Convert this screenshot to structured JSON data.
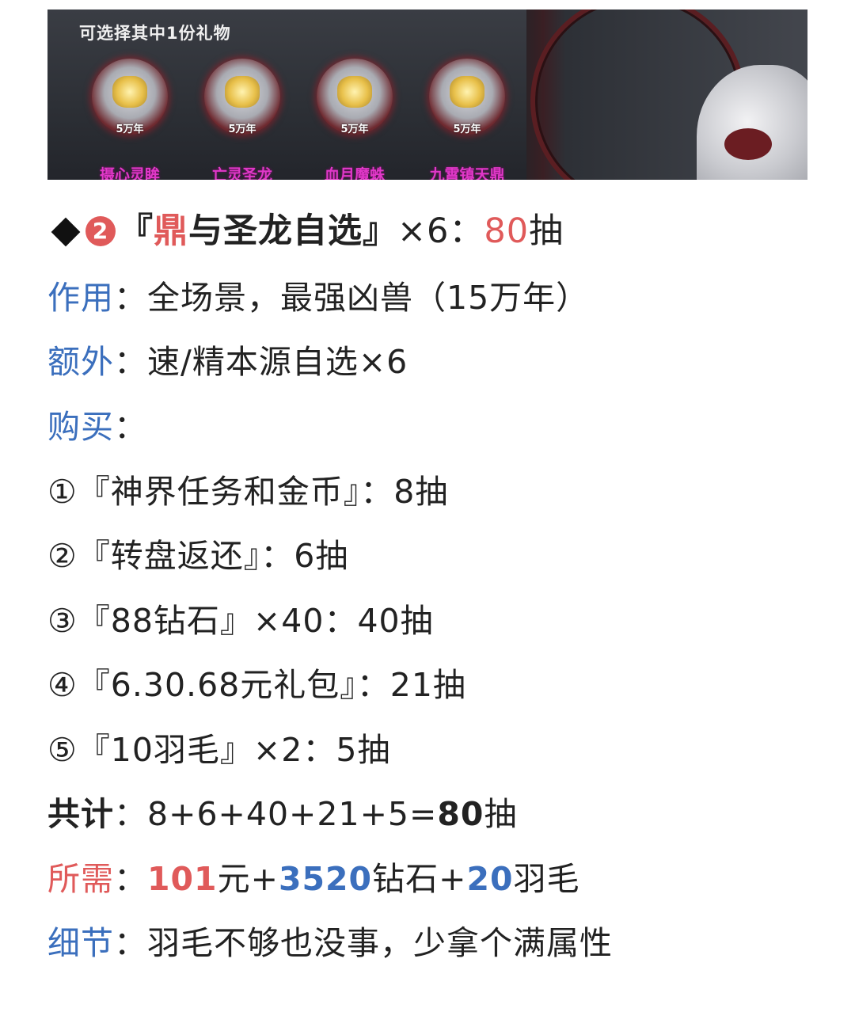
{
  "banner": {
    "title": "可选择其中1份礼物",
    "gifts": [
      {
        "years": "5万年",
        "name": "摄心灵眸",
        "icon": "eye-emblem-icon"
      },
      {
        "years": "5万年",
        "name": "亡灵圣龙",
        "icon": "dragon-emblem-icon"
      },
      {
        "years": "5万年",
        "name": "血月魔蛛",
        "icon": "beast-emblem-icon"
      },
      {
        "years": "5万年",
        "name": "九霄镇天鼎",
        "icon": "cauldron-emblem-icon"
      }
    ]
  },
  "heading": {
    "number": "2",
    "open_quote": "『",
    "title_red": "鼎",
    "title_rest": "与圣龙自选",
    "close_quote": "』",
    "multiplier": "×6：",
    "draws": "80",
    "draws_unit": "抽"
  },
  "effect": {
    "label": "作用",
    "colon": "：",
    "value": "全场景，最强凶兽（15万年）"
  },
  "extra": {
    "label": "额外",
    "colon": "：",
    "value": "速/精本源自选×6"
  },
  "purchase": {
    "label": "购买",
    "colon": "："
  },
  "items": [
    "①『神界任务和金币』：8抽",
    "②『转盘返还』：6抽",
    "③『88钻石』×40：40抽",
    "④『6.30.68元礼包』：21抽",
    "⑤『10羽毛』×2：5抽"
  ],
  "total": {
    "label": "共计",
    "colon": "：",
    "formula": "8+6+40+21+5=",
    "sum": "80",
    "unit": "抽"
  },
  "need": {
    "label": "所需",
    "colon": "：",
    "yuan": "101",
    "yuan_unit": "元+",
    "diamonds": "3520",
    "diamonds_unit": "钻石+",
    "feathers": "20",
    "feathers_unit": "羽毛"
  },
  "detail": {
    "label": "细节",
    "colon": "：",
    "value": "羽毛不够也没事，少拿个满属性"
  },
  "colors": {
    "accent_red": "#e05a5a",
    "accent_blue": "#3b6fbd",
    "gift_name": "#e038c8"
  }
}
